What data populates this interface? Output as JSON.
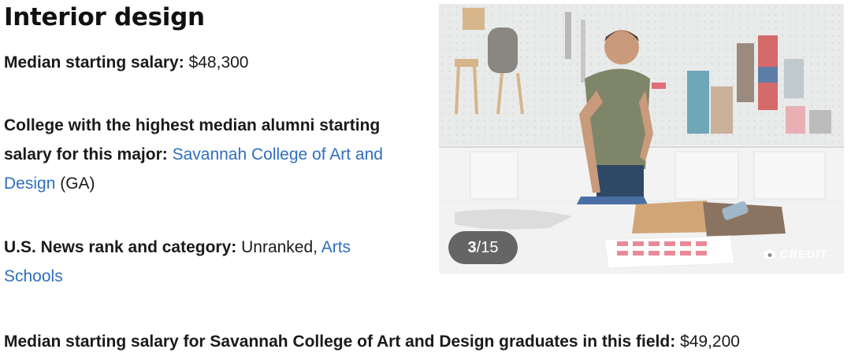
{
  "heading": "Interior design",
  "median_salary": {
    "label": "Median starting salary:",
    "value": "$48,300"
  },
  "top_college": {
    "label": "College with the highest median alumni starting salary for this major:",
    "college_link": "Savannah College of Art and Design",
    "state": "(GA)"
  },
  "rank": {
    "label": "U.S. News rank and category:",
    "value": "Unranked,",
    "category_link": "Arts Schools"
  },
  "college_salary": {
    "label": "Median starting salary for Savannah College of Art and Design graduates in this field:",
    "value": "$49,200"
  },
  "gallery": {
    "current": "3",
    "total": "/15",
    "credit_label": "CREDIT",
    "credit_icon": "camera-icon"
  }
}
